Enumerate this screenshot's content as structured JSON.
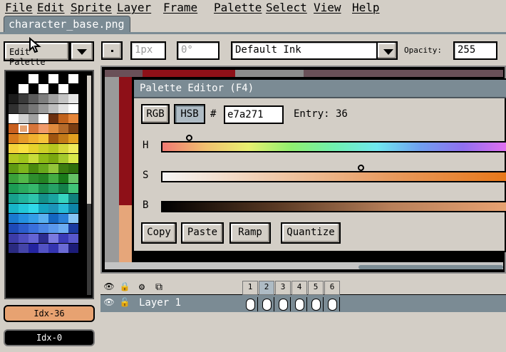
{
  "menu": [
    "File",
    "Edit",
    "Sprite",
    "Layer",
    "Frame",
    "Palette",
    "Select",
    "View",
    "Help"
  ],
  "tab": {
    "title": "character_base.png"
  },
  "toolbar": {
    "edit_palette_label": "Edit Palette",
    "brush_size": "1px",
    "angle": "0°",
    "ink": "Default Ink",
    "opacity_label": "Opacity:",
    "opacity_value": "255"
  },
  "palette_colors": [
    "#000000",
    "#000000",
    "#ffffff",
    "#000000",
    "#ffffff",
    "#000000",
    "#ffffff",
    "#000000",
    "#ffffff",
    "#000000",
    "#ffffff",
    "#000000",
    "#ffffff",
    "#000000",
    "#1b1b1b",
    "#3a3a3a",
    "#5c5c5c",
    "#7e7e7e",
    "#a1a1a1",
    "#c3c3c3",
    "#e6e6e6",
    "#303030",
    "#555555",
    "#777777",
    "#9a9a9a",
    "#bdbdbd",
    "#e0e0e0",
    "#ffffff",
    "#ffffff",
    "#d0d0d0",
    "#a0a0a0",
    "#ffffff",
    "#6b2f0f",
    "#c1621c",
    "#e6863a",
    "#c9601f",
    "#e7a271",
    "#d7753a",
    "#f19a6a",
    "#e08a3d",
    "#b56a2a",
    "#7a3d12",
    "#d87a1d",
    "#e69a2a",
    "#f0b030",
    "#f6c33a",
    "#a05510",
    "#c37a18",
    "#e3a020",
    "#f4d23a",
    "#f8e040",
    "#e6d22c",
    "#ccd028",
    "#b7c71f",
    "#d6d83a",
    "#f0ea5a",
    "#b0c820",
    "#9ec41c",
    "#c8dd3a",
    "#8fba16",
    "#7aa70f",
    "#a3c92c",
    "#d8e84a",
    "#5f9a12",
    "#7db51c",
    "#4a8a0e",
    "#68a81c",
    "#93c53a",
    "#3c7c10",
    "#2e6e0c",
    "#3aa03a",
    "#52b84a",
    "#2e8e2e",
    "#248224",
    "#44ac44",
    "#1a7a1a",
    "#65c265",
    "#1c9c54",
    "#2aaa60",
    "#36b86c",
    "#1a8c4c",
    "#26a266",
    "#14804a",
    "#40c478",
    "#18a08c",
    "#22b49c",
    "#2ec4ac",
    "#14908a",
    "#1aa4a0",
    "#36d4c0",
    "#10807c",
    "#18b4c8",
    "#22c8d8",
    "#30d8e8",
    "#14a4c0",
    "#1c94b8",
    "#28bcd8",
    "#0e84a8",
    "#1a7ad0",
    "#2490e0",
    "#349ee8",
    "#5ab0f0",
    "#1466c0",
    "#2a80d8",
    "#86c4f4",
    "#1e4ab8",
    "#2c5ccc",
    "#3a70dc",
    "#4a84e4",
    "#5a98ec",
    "#6cacf2",
    "#1a3aa0",
    "#3c3ca8",
    "#4e4ec0",
    "#6464d4",
    "#2c2c90",
    "#7a7ae0",
    "#3a3ab8",
    "#5858cc",
    "#2a2a80",
    "#4444a8",
    "#2424a0",
    "#5252c4",
    "#3434b0",
    "#6a6ad4",
    "#1c1c78"
  ],
  "sidebar": {
    "fg_index": "Idx-36",
    "bg_index": "Idx-0"
  },
  "palette_editor": {
    "title": "Palette Editor (F4)",
    "rgb_label": "RGB",
    "hsb_label": "HSB",
    "hash": "#",
    "hex_value": "e7a271",
    "entry_label": "Entry: 36",
    "h_label": "H",
    "s_label": "S",
    "b_label": "B",
    "hue_position": 0.08,
    "saturation_position": 0.58,
    "buttons": [
      "Copy",
      "Paste",
      "Ramp",
      "Quantize"
    ]
  },
  "timeline": {
    "frames": [
      "1",
      "2",
      "3",
      "4",
      "5",
      "6"
    ],
    "current_frame": "2",
    "layer_name": "Layer 1"
  }
}
